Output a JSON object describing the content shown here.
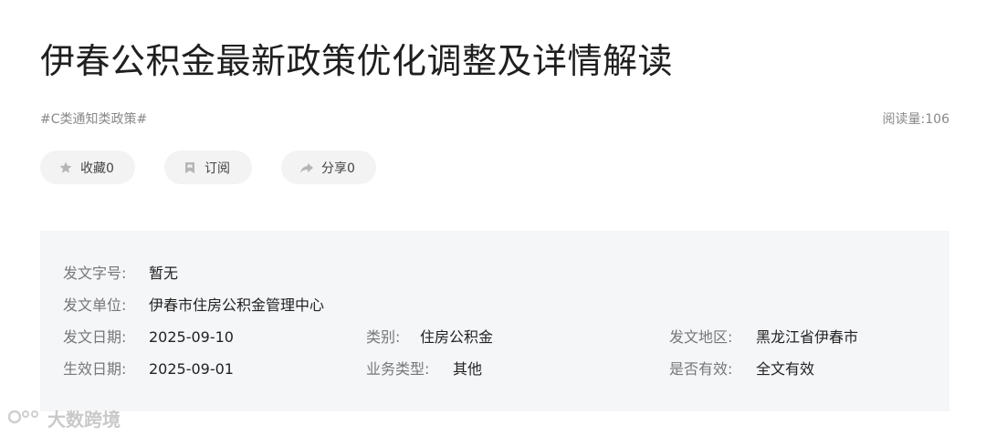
{
  "article": {
    "title": "伊春公积金最新政策优化调整及详情解读",
    "tag": "#C类通知类政策#",
    "read_count": "阅读量:106"
  },
  "actions": {
    "collect_label": "收藏0",
    "subscribe_label": "订阅",
    "share_label": "分享0"
  },
  "info": {
    "doc_number_label": "发文字号:",
    "doc_number_value": "暂无",
    "issuer_label": "发文单位:",
    "issuer_value": "伊春市住房公积金管理中心",
    "issue_date_label": "发文日期:",
    "issue_date_value": "2025-09-10",
    "category_label": "类别:",
    "category_value": "住房公积金",
    "region_label": "发文地区:",
    "region_value": "黑龙江省伊春市",
    "effective_date_label": "生效日期:",
    "effective_date_value": "2025-09-01",
    "business_type_label": "业务类型:",
    "business_type_value": "其他",
    "valid_label": "是否有效:",
    "valid_value": "全文有效"
  },
  "watermark": {
    "text": "大数跨境"
  },
  "icons": {
    "collect": "star-icon",
    "subscribe": "bookmark-icon",
    "share": "share-arrow-icon"
  }
}
